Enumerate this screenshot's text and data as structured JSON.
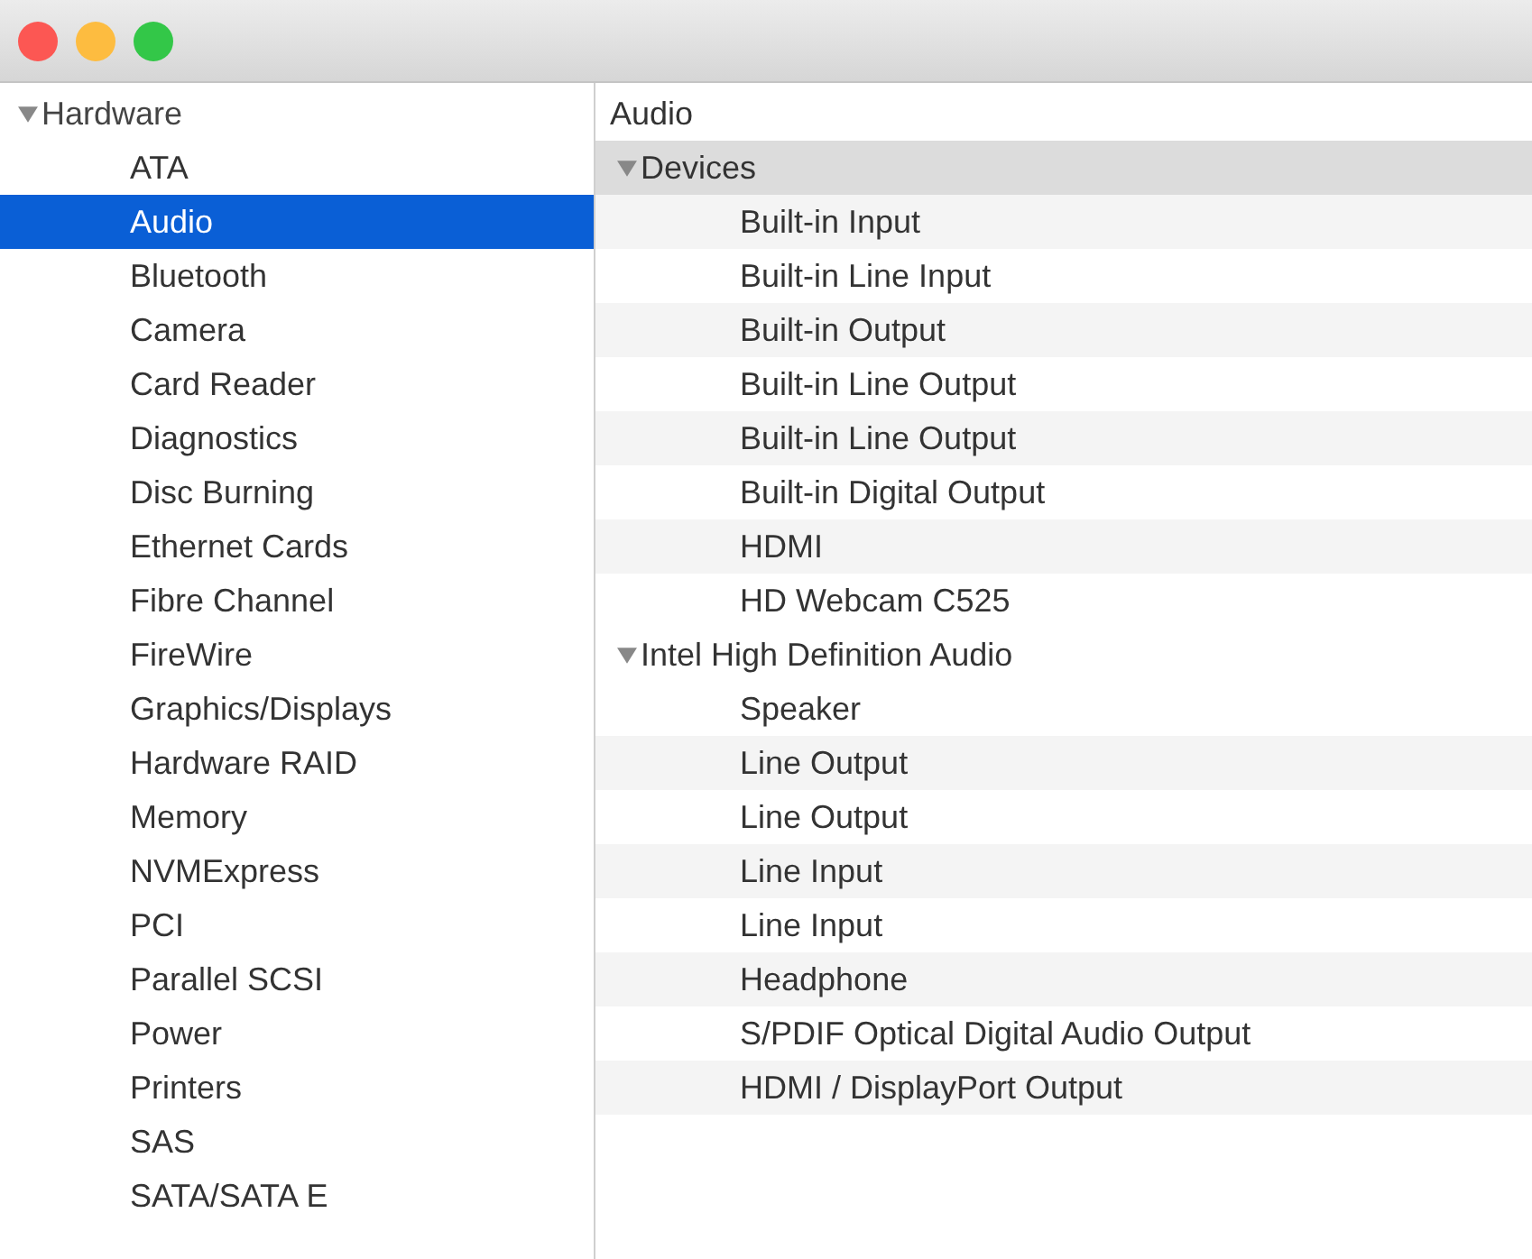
{
  "sidebar": {
    "items": [
      {
        "label": "Hardware",
        "expanded": true,
        "selected": false,
        "children": [
          {
            "label": "ATA",
            "selected": false
          },
          {
            "label": "Audio",
            "selected": true
          },
          {
            "label": "Bluetooth",
            "selected": false
          },
          {
            "label": "Camera",
            "selected": false
          },
          {
            "label": "Card Reader",
            "selected": false
          },
          {
            "label": "Diagnostics",
            "selected": false
          },
          {
            "label": "Disc Burning",
            "selected": false
          },
          {
            "label": "Ethernet Cards",
            "selected": false
          },
          {
            "label": "Fibre Channel",
            "selected": false
          },
          {
            "label": "FireWire",
            "selected": false
          },
          {
            "label": "Graphics/Displays",
            "selected": false
          },
          {
            "label": "Hardware RAID",
            "selected": false
          },
          {
            "label": "Memory",
            "selected": false
          },
          {
            "label": "NVMExpress",
            "selected": false
          },
          {
            "label": "PCI",
            "selected": false
          },
          {
            "label": "Parallel SCSI",
            "selected": false
          },
          {
            "label": "Power",
            "selected": false
          },
          {
            "label": "Printers",
            "selected": false
          },
          {
            "label": "SAS",
            "selected": false
          },
          {
            "label": "SATA/SATA E",
            "selected": false
          }
        ]
      }
    ]
  },
  "detail": {
    "title": "Audio",
    "groups": [
      {
        "label": "Devices",
        "expanded": true,
        "children": [
          "Built-in Input",
          "Built-in Line Input",
          "Built-in Output",
          "Built-in Line Output",
          "Built-in Line Output",
          "Built-in Digital Output",
          "HDMI",
          "HD Webcam C525"
        ]
      },
      {
        "label": "Intel High Definition Audio",
        "expanded": true,
        "children": [
          "Speaker",
          "Line Output",
          "Line Output",
          "Line Input",
          "Line Input",
          "Headphone",
          "S/PDIF Optical Digital Audio Output",
          "HDMI / DisplayPort Output"
        ]
      }
    ]
  }
}
